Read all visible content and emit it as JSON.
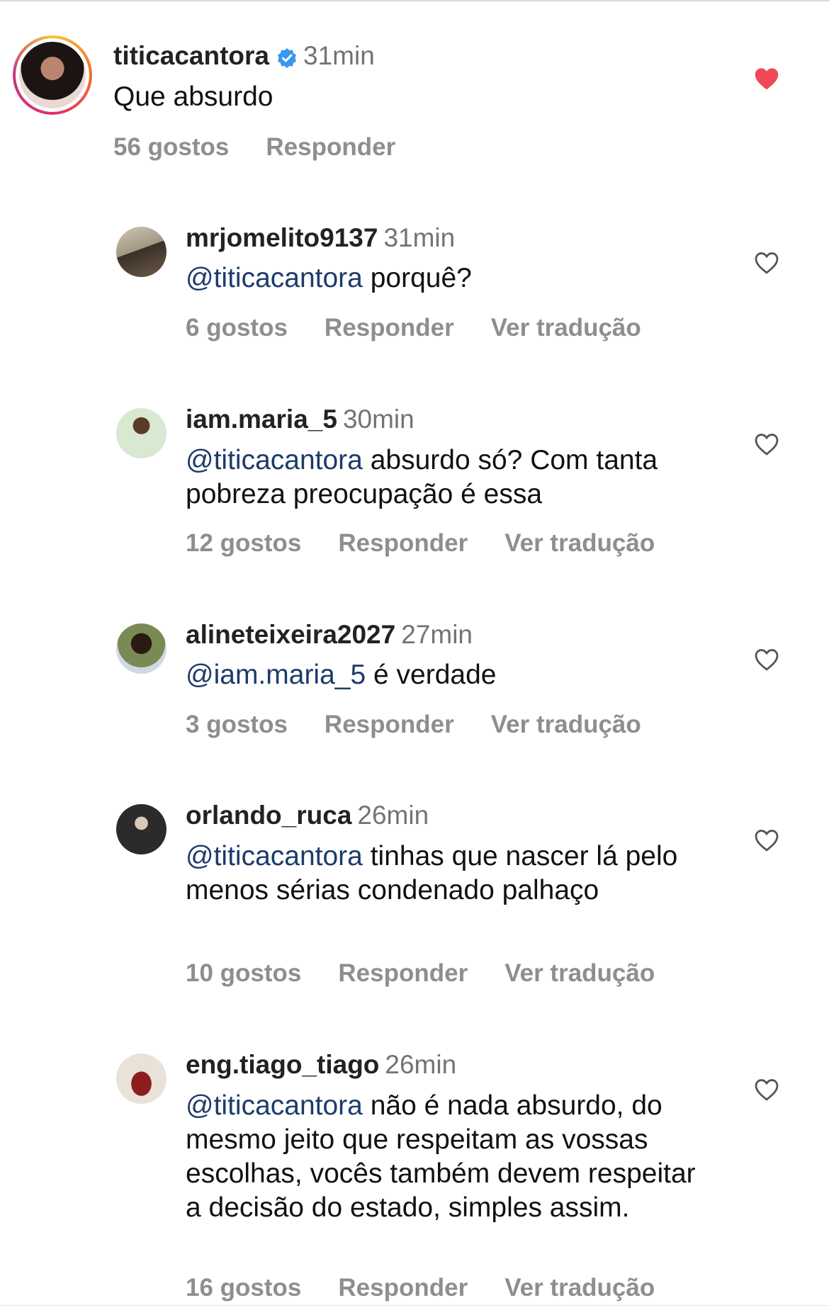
{
  "comments": [
    {
      "username": "titicacantora",
      "verified": true,
      "time": "31min",
      "mention": "",
      "text": "Que absurdo",
      "likes": "56 gostos",
      "reply": "Responder",
      "translate": "",
      "liked": true
    },
    {
      "username": "mrjomelito9137",
      "verified": false,
      "time": "31min",
      "mention": "@titicacantora",
      "text": "porquê?",
      "likes": "6 gostos",
      "reply": "Responder",
      "translate": "Ver tradução",
      "liked": false
    },
    {
      "username": "iam.maria_5",
      "verified": false,
      "time": "30min",
      "mention": "@titicacantora",
      "text": "absurdo só? Com tanta pobreza preocupação é essa",
      "likes": "12 gostos",
      "reply": "Responder",
      "translate": "Ver tradução",
      "liked": false
    },
    {
      "username": "alineteixeira2027",
      "verified": false,
      "time": "27min",
      "mention": "@iam.maria_5",
      "text": "é verdade",
      "likes": "3 gostos",
      "reply": "Responder",
      "translate": "Ver tradução",
      "liked": false
    },
    {
      "username": "orlando_ruca",
      "verified": false,
      "time": "26min",
      "mention": "@titicacantora",
      "text": "tinhas que nascer lá pelo menos sérias condenado palhaço",
      "likes": "10 gostos",
      "reply": "Responder",
      "translate": "Ver tradução",
      "liked": false
    },
    {
      "username": "eng.tiago_tiago",
      "verified": false,
      "time": "26min",
      "mention": "@titicacantora",
      "text": "não é nada absurdo, do mesmo jeito que respeitam as vossas escolhas, vocês também devem respeitar a decisão do estado, simples assim.",
      "likes": "16 gostos",
      "reply": "Responder",
      "translate": "Ver tradução",
      "liked": false
    }
  ],
  "colors": {
    "mention": "#1d3b6b",
    "like_red": "#ed4956",
    "meta_gray": "#8e8e8e",
    "verified_blue": "#3897f0"
  }
}
